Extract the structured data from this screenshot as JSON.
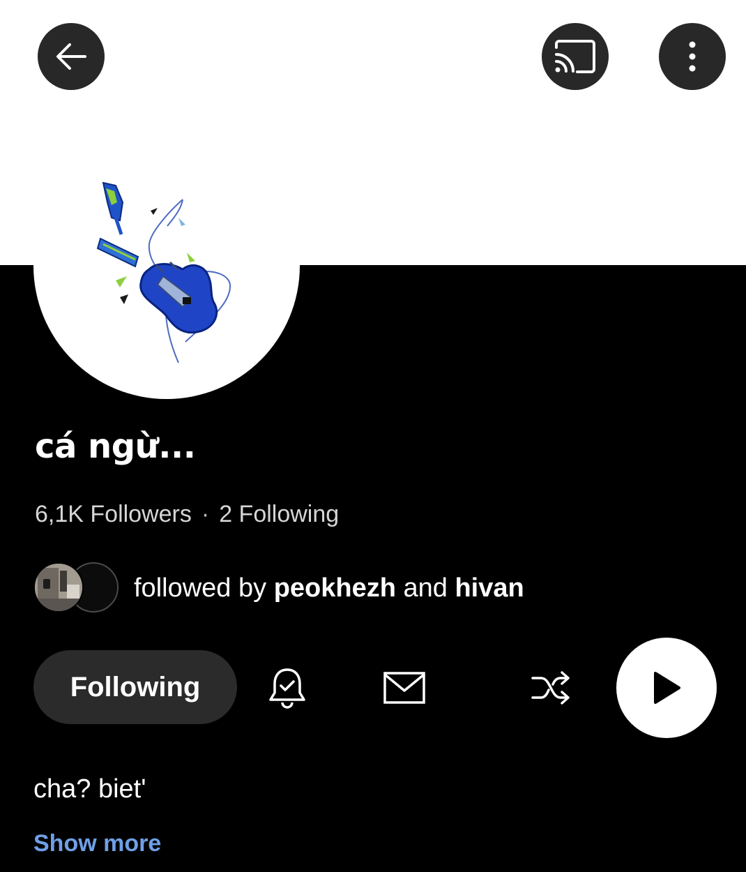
{
  "header": {
    "back_icon": "arrow-left-icon",
    "cast_icon": "cast-icon",
    "more_icon": "more-vertical-icon"
  },
  "profile": {
    "avatar_description_icon": "guitar-drawing-avatar",
    "name": "cá ngừ...",
    "followers_count": "6,1K Followers",
    "separator": "·",
    "following_count": "2 Following"
  },
  "followed_by": {
    "prefix": "followed by",
    "user1": "peokhezh",
    "connector": "and",
    "user2": "hivan"
  },
  "actions": {
    "following_label": "Following",
    "bell_icon": "bell-check-icon",
    "mail_icon": "mail-icon",
    "shuffle_icon": "shuffle-icon",
    "play_icon": "play-icon"
  },
  "bio": {
    "text": "cha? biet'",
    "show_more_label": "Show more"
  },
  "colors": {
    "background_dark": "#000000",
    "button_dark": "#2b2b2b",
    "link_blue": "#6fa0e6"
  }
}
